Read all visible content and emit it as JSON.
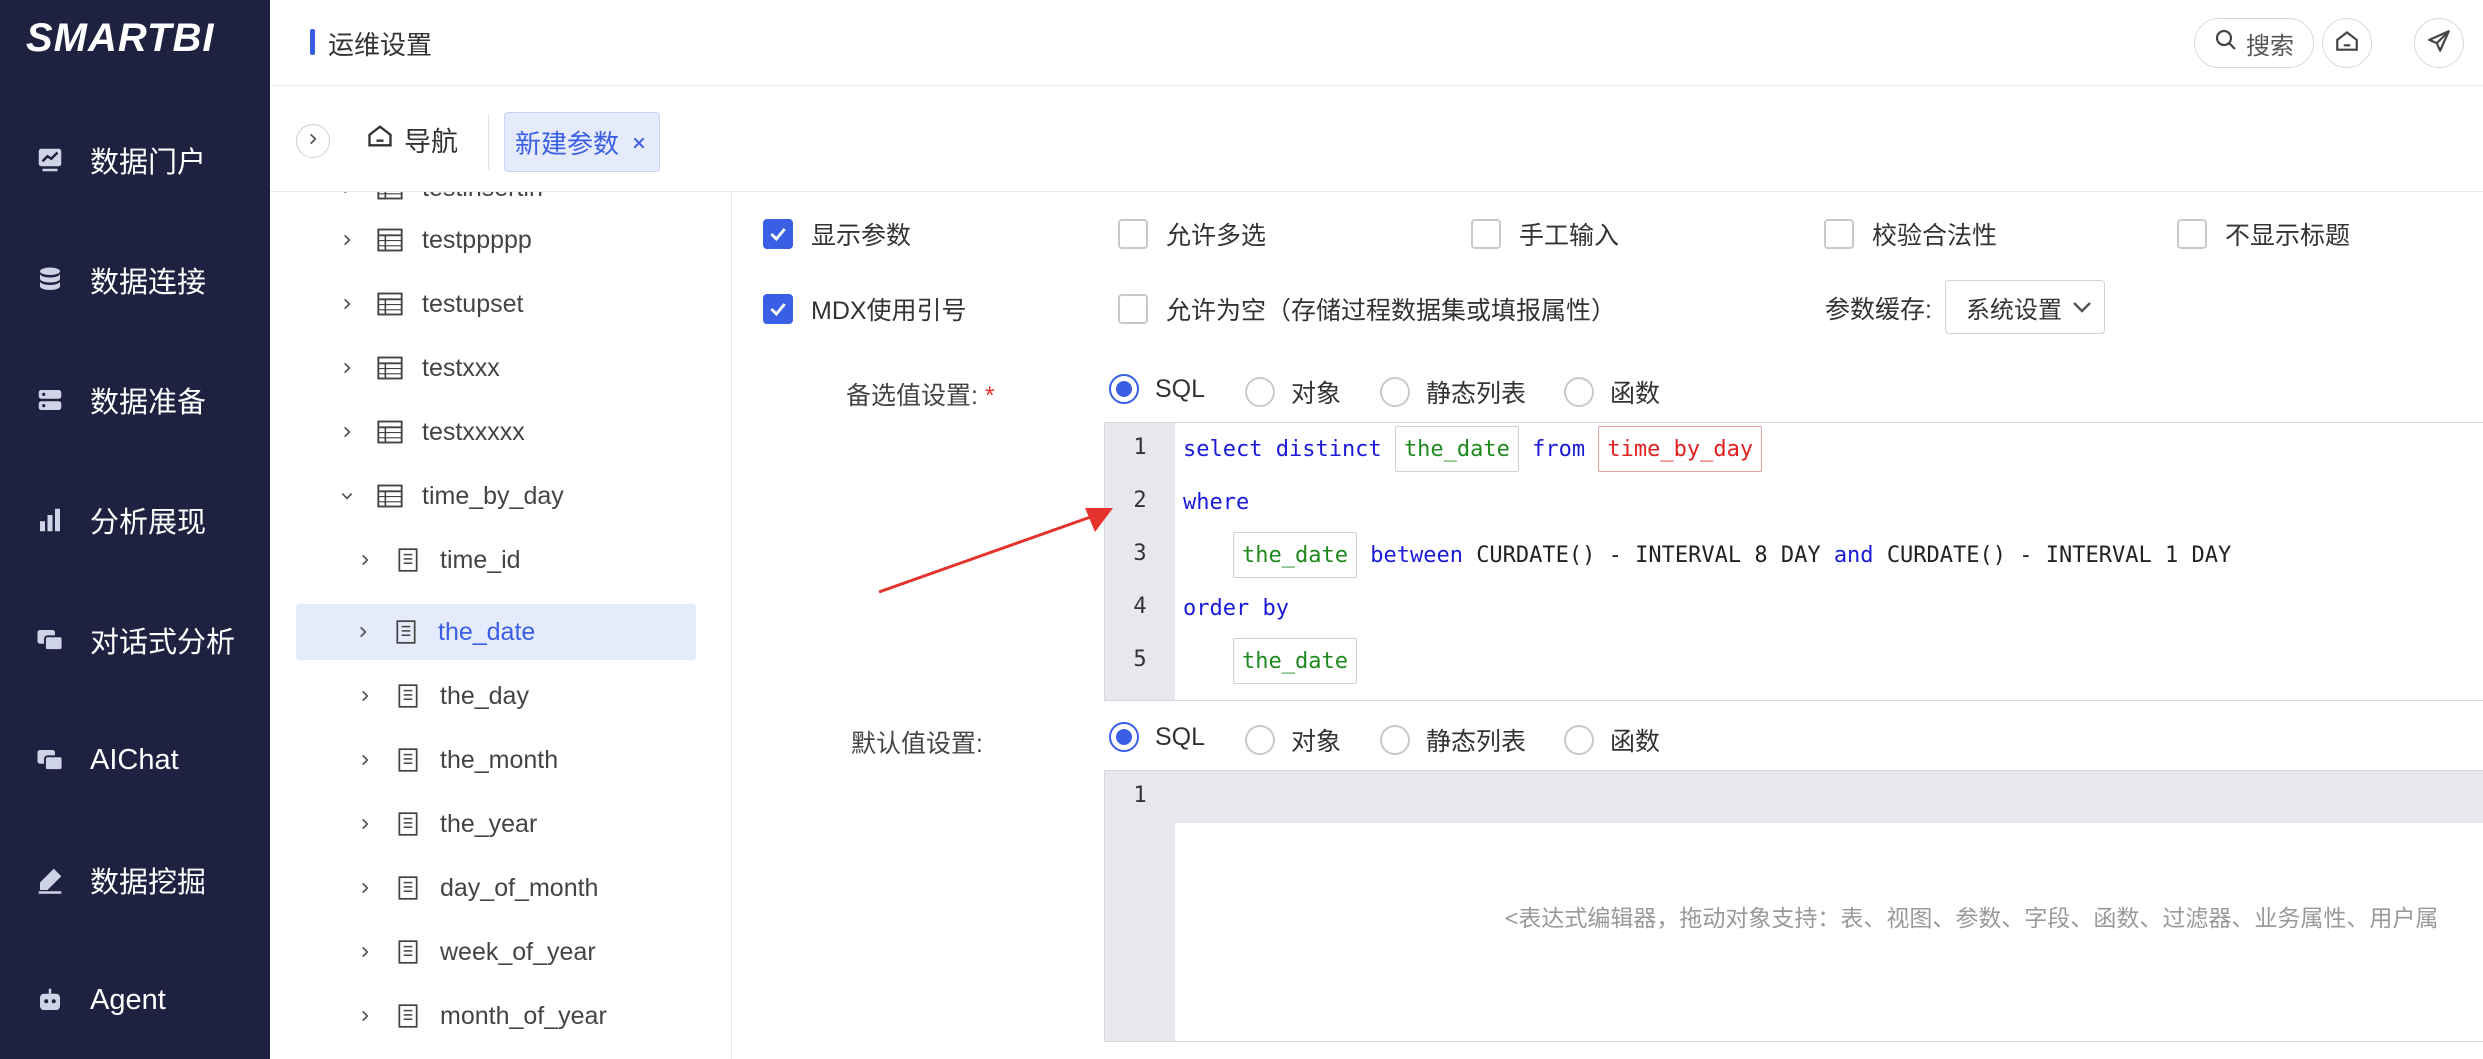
{
  "app": {
    "logo": "SMARTBI",
    "header_title": "运维设置",
    "search_label": "搜索"
  },
  "leftnav": {
    "items": [
      {
        "label": "数据门户",
        "icon": "chart-board-icon"
      },
      {
        "label": "数据连接",
        "icon": "database-icon"
      },
      {
        "label": "数据准备",
        "icon": "server-icon"
      },
      {
        "label": "分析展现",
        "icon": "bar-chart-icon"
      },
      {
        "label": "对话式分析",
        "icon": "chat-icon"
      },
      {
        "label": "AIChat",
        "icon": "ai-chat-icon"
      },
      {
        "label": "数据挖掘",
        "icon": "mining-pen-icon"
      },
      {
        "label": "Agent",
        "icon": "robot-icon"
      }
    ]
  },
  "tabs": {
    "home_label": "导航",
    "active_label": "新建参数"
  },
  "tree": {
    "items": [
      {
        "label": "testinsertin",
        "level": 0,
        "expanded": false,
        "selected": false
      },
      {
        "label": "testppppp",
        "level": 0,
        "expanded": false,
        "selected": false
      },
      {
        "label": "testupset",
        "level": 0,
        "expanded": false,
        "selected": false
      },
      {
        "label": "testxxx",
        "level": 0,
        "expanded": false,
        "selected": false
      },
      {
        "label": "testxxxxx",
        "level": 0,
        "expanded": false,
        "selected": false
      },
      {
        "label": "time_by_day",
        "level": 0,
        "expanded": true,
        "selected": false
      },
      {
        "label": "time_id",
        "level": 1,
        "expanded": false,
        "selected": false
      },
      {
        "label": "the_date",
        "level": 1,
        "expanded": false,
        "selected": true
      },
      {
        "label": "the_day",
        "level": 1,
        "expanded": false,
        "selected": false
      },
      {
        "label": "the_month",
        "level": 1,
        "expanded": false,
        "selected": false
      },
      {
        "label": "the_year",
        "level": 1,
        "expanded": false,
        "selected": false
      },
      {
        "label": "day_of_month",
        "level": 1,
        "expanded": false,
        "selected": false
      },
      {
        "label": "week_of_year",
        "level": 1,
        "expanded": false,
        "selected": false
      },
      {
        "label": "month_of_year",
        "level": 1,
        "expanded": false,
        "selected": false
      }
    ]
  },
  "options": {
    "row1": [
      {
        "label": "显示参数",
        "checked": true
      },
      {
        "label": "允许多选",
        "checked": false
      },
      {
        "label": "手工输入",
        "checked": false
      },
      {
        "label": "校验合法性",
        "checked": false
      },
      {
        "label": "不显示标题",
        "checked": false
      }
    ],
    "row2": [
      {
        "label": "MDX使用引号",
        "checked": true
      },
      {
        "label": "允许为空（存储过程数据集或填报属性）",
        "checked": false
      }
    ],
    "cache_label": "参数缓存:",
    "cache_value": "系统设置"
  },
  "candidate": {
    "label": "备选值设置:",
    "required_mark": "*",
    "radios": [
      "SQL",
      "对象",
      "静态列表",
      "函数"
    ],
    "selected": "SQL",
    "code": {
      "line_numbers": [
        "1",
        "2",
        "3",
        "4",
        "5"
      ],
      "l1_select": "select distinct",
      "l1_field": "the_date",
      "l1_from": "from",
      "l1_table": "time_by_day",
      "l2_where": "where",
      "l3_field": "the_date",
      "l3_between": "between",
      "l3_expr1": "CURDATE() - INTERVAL 8 DAY",
      "l3_and": "and",
      "l3_expr2": "CURDATE() - INTERVAL 1 DAY",
      "l4_order": "order by",
      "l5_field": "the_date"
    }
  },
  "default_value": {
    "label": "默认值设置:",
    "radios": [
      "SQL",
      "对象",
      "静态列表",
      "函数"
    ],
    "selected": "SQL",
    "line_numbers": [
      "1"
    ],
    "placeholder": "<表达式编辑器，拖动对象支持：表、视图、参数、字段、函数、过滤器、业务属性、用户属"
  },
  "colors": {
    "nav_bg": "#1f2140",
    "accent": "#3a5fe5",
    "arrow": "#e5322d"
  }
}
